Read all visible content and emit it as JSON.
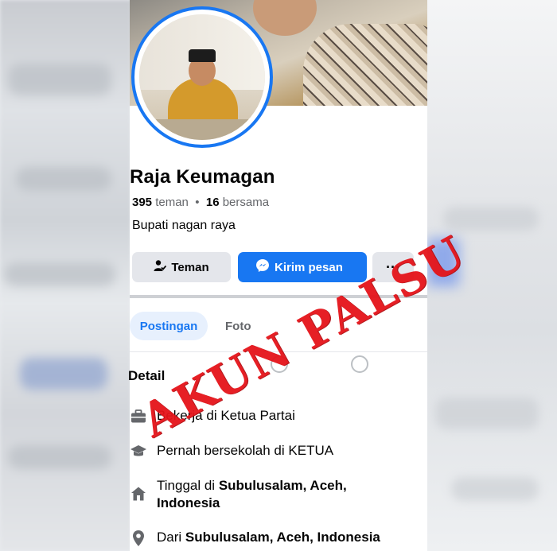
{
  "profile": {
    "name": "Raja Keumagan",
    "friends_count": "395",
    "friends_label": "teman",
    "mutual_count": "16",
    "mutual_label": "bersama",
    "separator": "•",
    "bio": "Bupati nagan raya"
  },
  "actions": {
    "friend_label": "Teman",
    "message_label": "Kirim pesan",
    "more_label": "···"
  },
  "tabs": [
    {
      "label": "Postingan",
      "active": true
    },
    {
      "label": "Foto",
      "active": false
    }
  ],
  "details": {
    "title": "Detail",
    "items": [
      {
        "icon": "briefcase-icon",
        "prefix": "Bekerja di Ketua Partai",
        "bold": ""
      },
      {
        "icon": "graduation-cap-icon",
        "prefix": "Pernah bersekolah di KETUA",
        "bold": ""
      },
      {
        "icon": "home-icon",
        "prefix": "Tinggal di ",
        "bold": "Subulusalam, Aceh, Indonesia"
      },
      {
        "icon": "location-pin-icon",
        "prefix": "Dari ",
        "bold": "Subulusalam, Aceh, Indonesia"
      }
    ]
  },
  "watermark": "AKUN PALSU",
  "colors": {
    "accent": "#1877f2",
    "stamp": "#e5141a",
    "secondary_button": "#e4e6eb"
  }
}
